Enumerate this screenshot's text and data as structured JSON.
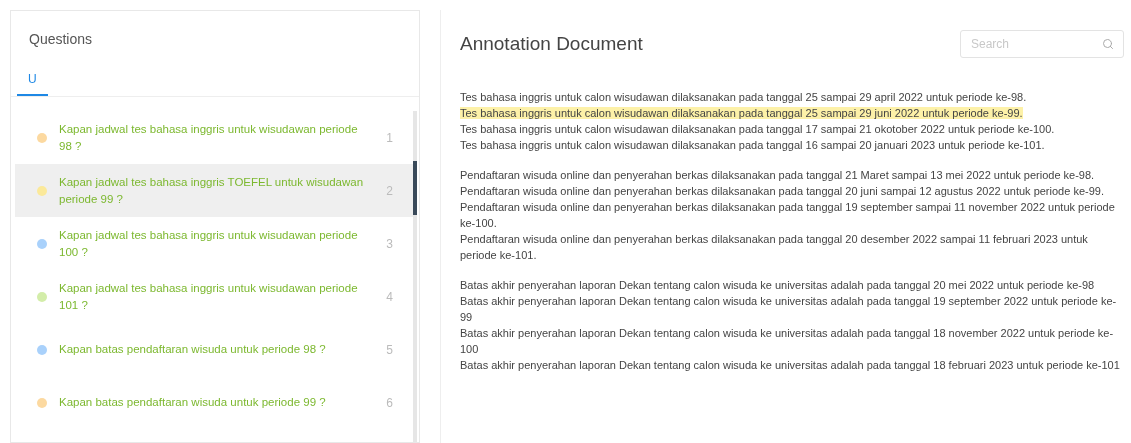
{
  "questions_panel": {
    "title": "Questions",
    "tabs": [
      {
        "label": "U",
        "selected": true
      }
    ],
    "questions": [
      {
        "text": "Kapan jadwal tes bahasa inggris untuk wisudawan periode 98 ?",
        "number": "1",
        "color": "#fcd9a0",
        "selected": false
      },
      {
        "text": "Kapan jadwal tes bahasa inggris TOEFEL untuk wisudawan periode 99 ?",
        "number": "2",
        "color": "#fbe99a",
        "selected": true
      },
      {
        "text": "Kapan jadwal tes bahasa inggris untuk wisudawan periode 100 ?",
        "number": "3",
        "color": "#a9d1fb",
        "selected": false
      },
      {
        "text": "Kapan jadwal tes bahasa inggris untuk wisudawan periode 101 ?",
        "number": "4",
        "color": "#d3eda9",
        "selected": false
      },
      {
        "text": "Kapan batas pendaftaran wisuda untuk periode 98 ?",
        "number": "5",
        "color": "#a9d1fb",
        "selected": false
      },
      {
        "text": "Kapan batas pendaftaran wisuda untuk periode 99 ?",
        "number": "6",
        "color": "#fcd9a0",
        "selected": false
      }
    ]
  },
  "document_panel": {
    "title": "Annotation Document",
    "search": {
      "placeholder": "Search"
    },
    "paragraphs": [
      [
        {
          "text": "Tes bahasa inggris untuk calon wisudawan dilaksanakan pada tanggal 25 sampai 29 april 2022 untuk periode ke-98.",
          "highlighted": false
        },
        {
          "text": "Tes bahasa inggris untuk calon wisudawan dilaksanakan pada tanggal 25 sampai 29 juni 2022 untuk periode ke-99.",
          "highlighted": true
        },
        {
          "text": "Tes bahasa inggris untuk calon wisudawan dilaksanakan pada tanggal 17 sampai 21 okotober 2022 untuk periode ke-100.",
          "highlighted": false
        },
        {
          "text": "Tes bahasa inggris untuk calon wisudawan dilaksanakan pada tanggal 16 sampai 20 januari 2023 untuk periode ke-101.",
          "highlighted": false
        }
      ],
      [
        {
          "text": "Pendaftaran wisuda online dan penyerahan berkas dilaksanakan pada tanggal 21 Maret sampai 13 mei 2022 untuk periode ke-98.",
          "highlighted": false
        },
        {
          "text": "Pendaftaran wisuda online dan penyerahan berkas dilaksanakan pada tanggal 20 juni sampai 12 agustus 2022 untuk periode ke-99.",
          "highlighted": false
        },
        {
          "text": "Pendaftaran wisuda online dan penyerahan berkas dilaksanakan pada tanggal 19 september sampai 11 november 2022 untuk periode ke-100.",
          "highlighted": false
        },
        {
          "text": "Pendaftaran wisuda online dan penyerahan berkas dilaksanakan pada tanggal 20 desember 2022 sampai 11 februari 2023 untuk periode ke-101.",
          "highlighted": false
        }
      ],
      [
        {
          "text": "Batas akhir penyerahan laporan Dekan tentang calon wisuda ke universitas adalah pada tanggal 20 mei 2022 untuk periode ke-98",
          "highlighted": false
        },
        {
          "text": "Batas akhir penyerahan laporan Dekan tentang calon wisuda ke universitas adalah pada tanggal 19 september 2022 untuk periode ke-99",
          "highlighted": false
        },
        {
          "text": "Batas akhir penyerahan laporan Dekan tentang calon wisuda ke universitas adalah pada tanggal 18 november 2022 untuk periode ke-100",
          "highlighted": false
        },
        {
          "text": "Batas akhir penyerahan laporan Dekan tentang calon wisuda ke universitas adalah pada tanggal 18 februari 2023 untuk periode ke-101",
          "highlighted": false
        }
      ]
    ]
  }
}
